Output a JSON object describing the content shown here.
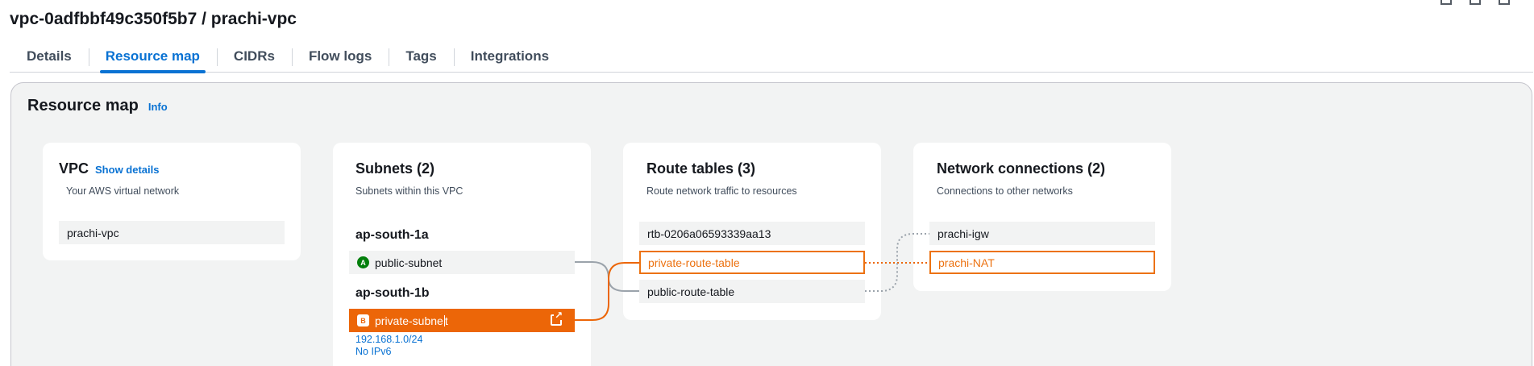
{
  "page": {
    "title": "vpc-0adfbbf49c350f5b7 / prachi-vpc"
  },
  "tabs": [
    {
      "label": "Details",
      "active": false
    },
    {
      "label": "Resource map",
      "active": true
    },
    {
      "label": "CIDRs",
      "active": false
    },
    {
      "label": "Flow logs",
      "active": false
    },
    {
      "label": "Tags",
      "active": false
    },
    {
      "label": "Integrations",
      "active": false
    }
  ],
  "resource_map": {
    "title": "Resource map",
    "info_label": "Info",
    "vpc": {
      "title": "VPC",
      "show_details": "Show details",
      "subtitle": "Your AWS virtual network",
      "items": [
        "prachi-vpc"
      ]
    },
    "subnets": {
      "title": "Subnets (2)",
      "subtitle": "Subnets within this VPC",
      "zones": [
        {
          "name": "ap-south-1a",
          "subnets": [
            {
              "badge": "A",
              "name": "public-subnet"
            }
          ]
        },
        {
          "name": "ap-south-1b",
          "subnets": [
            {
              "badge": "B",
              "name": "private-subne",
              "cursor_after": "t"
            }
          ]
        }
      ],
      "selected_cidr": "192.168.1.0/24",
      "selected_ipv6": "No IPv6"
    },
    "route_tables": {
      "title": "Route tables (3)",
      "subtitle": "Route network traffic to resources",
      "items": [
        "rtb-0206a06593339aa13",
        "private-route-table",
        "public-route-table"
      ]
    },
    "network_connections": {
      "title": "Network connections (2)",
      "subtitle": "Connections to other networks",
      "items": [
        "prachi-igw",
        "prachi-NAT"
      ]
    }
  },
  "colors": {
    "accent_link": "#0972d3",
    "highlight_orange": "#ec6608",
    "badge_green": "#037f0c",
    "panel_bg": "#f2f3f3"
  }
}
